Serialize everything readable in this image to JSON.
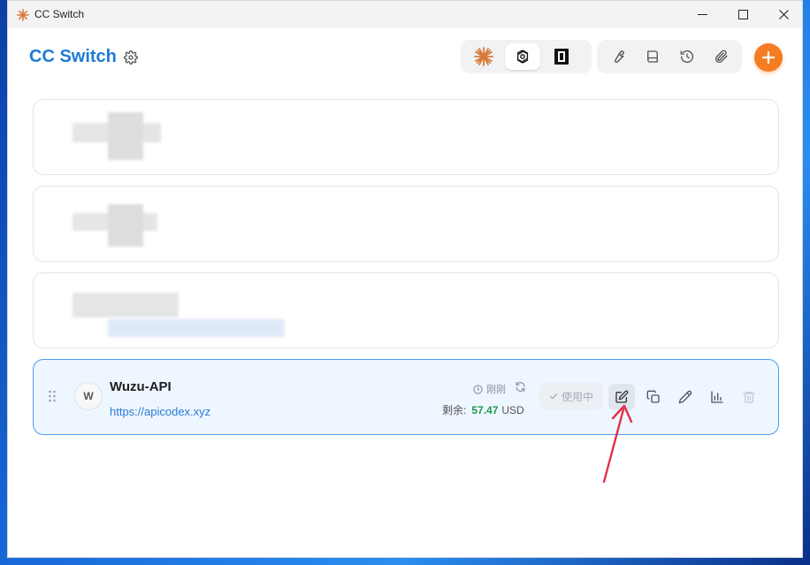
{
  "window": {
    "title": "CC Switch"
  },
  "header": {
    "title": "CC Switch",
    "app_switch": [
      {
        "name": "claude-icon",
        "active": false
      },
      {
        "name": "openai-icon",
        "active": true
      },
      {
        "name": "gemini-icon",
        "active": false
      }
    ],
    "tools": [
      "wrench-icon",
      "book-icon",
      "history-icon",
      "paperclip-icon"
    ]
  },
  "providers": [
    {
      "redacted": true
    },
    {
      "redacted": true
    },
    {
      "redacted": true
    },
    {
      "initial": "W",
      "name": "Wuzu-API",
      "url": "https://apicodex.xyz",
      "updated": "刚刚",
      "balance_label": "剩余:",
      "balance_amount": "57.47",
      "balance_unit": "USD",
      "status_label": "使用中"
    }
  ],
  "colors": {
    "accent": "#1e7ad6",
    "add_button": "#f57c22",
    "balance": "#1e9a49",
    "annotation": "#e3304a"
  }
}
